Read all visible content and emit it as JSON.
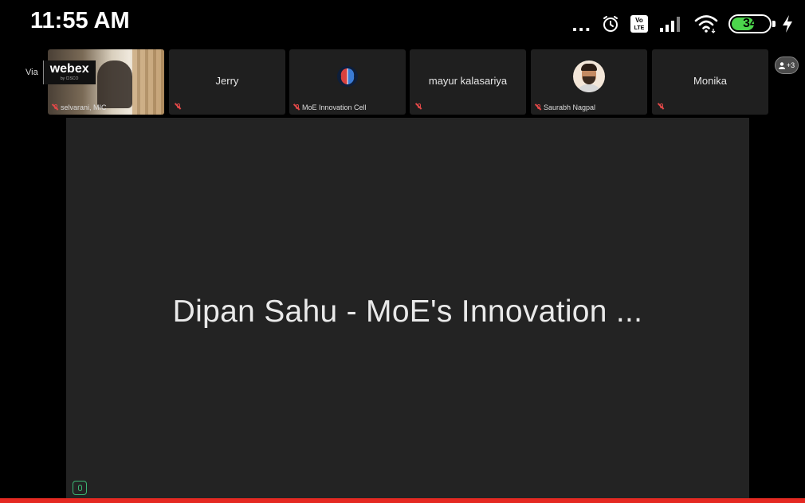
{
  "status_bar": {
    "time": "11:55 AM",
    "overflow_dots": "...",
    "battery_level": "34",
    "battery_fill": 0.55,
    "battery_color": "#4cd64c"
  },
  "app": {
    "via_label": "Via",
    "brand_name": "webex",
    "brand_sub": "by CISCO"
  },
  "participants": [
    {
      "name": "selvarani, MIC",
      "type": "video",
      "muted": true
    },
    {
      "name": "Jerry",
      "type": "name-only",
      "muted": true
    },
    {
      "name": "MoE Innovation Cell",
      "type": "logo",
      "muted": true
    },
    {
      "name": "mayur kalasariya",
      "type": "name-only",
      "muted": true
    },
    {
      "name": "Saurabh Nagpal",
      "type": "avatar",
      "muted": true
    },
    {
      "name": "Monika",
      "type": "name-only",
      "muted": true
    }
  ],
  "participants_button": {
    "count": "+3",
    "icon": "people-icon"
  },
  "stage": {
    "active_speaker": "Dipan Sahu - MoE's Innovation ...",
    "mic_color": "#3bb573"
  },
  "colors": {
    "background": "#000000",
    "tile": "#1f1f1f",
    "stage": "#232323",
    "muted_mic": "#e04848",
    "accent_bar": "#e52922"
  }
}
